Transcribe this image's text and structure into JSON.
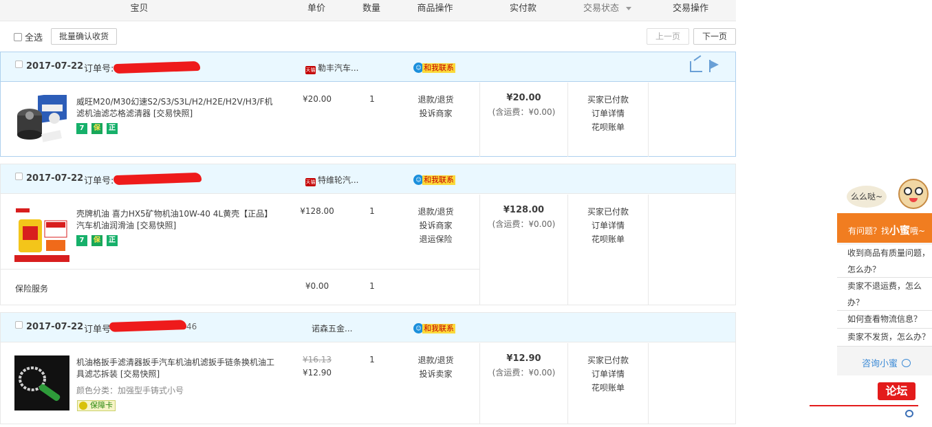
{
  "header": {
    "col_item": "宝贝",
    "col_price": "单价",
    "col_qty": "数量",
    "col_ops": "商品操作",
    "col_paid": "实付款",
    "col_status": "交易状态",
    "col_actions": "交易操作"
  },
  "toolbar": {
    "select_all": "全选",
    "batch_confirm": "批量确认收货",
    "prev_page": "上一页",
    "next_page": "下一页"
  },
  "orders": [
    {
      "date": "2017-07-22",
      "order_no_label": "订单号:",
      "order_no_tail": "",
      "shop": "勒丰汽车...",
      "contact": "和我联系",
      "items": [
        {
          "title": "威旺M20/M30幻速S2/S3/S3L/H2/H2E/H2V/H3/F机滤机油滤芯格滤清器",
          "snapshot": "[交易快照]",
          "badges": [
            "7",
            "保",
            "正"
          ],
          "price": "¥20.00",
          "qty": "1",
          "ops": [
            "退款/退货",
            "投诉商家"
          ]
        }
      ],
      "paid": "¥20.00",
      "shipping": "(含运费：¥0.00)",
      "status": [
        "买家已付款",
        "订单详情",
        "花呗账单"
      ]
    },
    {
      "date": "2017-07-22",
      "order_no_label": "订单号:",
      "order_no_tail": "",
      "shop": "特维轮汽...",
      "contact": "和我联系",
      "items": [
        {
          "title": "壳牌机油 喜力HX5矿物机油10W-40 4L黄壳【正品】汽车机油润滑油",
          "snapshot": "[交易快照]",
          "badges": [
            "7",
            "保",
            "正"
          ],
          "price": "¥128.00",
          "qty": "1",
          "ops": [
            "退款/退货",
            "投诉商家",
            "退运保险"
          ]
        },
        {
          "title": "保险服务",
          "price": "¥0.00",
          "qty": "1"
        }
      ],
      "paid": "¥128.00",
      "shipping": "(含运费：¥0.00)",
      "status": [
        "买家已付款",
        "订单详情",
        "花呗账单"
      ]
    },
    {
      "date": "2017-07-22",
      "order_no_label": "订单号",
      "order_no_tail": "46",
      "shop": "诺森五金...",
      "contact": "和我联系",
      "items": [
        {
          "title": "机油格扳手滤清器扳手汽车机油机滤扳手链条换机油工具滤芯拆装",
          "snapshot": "[交易快照]",
          "spec": "颜色分类：加强型手铸式小号",
          "badge_card": "保障卡",
          "price_old": "¥16.13",
          "price": "¥12.90",
          "qty": "1",
          "ops": [
            "退款/退货",
            "投诉卖家"
          ]
        }
      ],
      "paid": "¥12.90",
      "shipping": "(含运费：¥0.00)",
      "status": [
        "买家已付款",
        "订单详情",
        "花呗账单"
      ]
    }
  ],
  "widget": {
    "greeting": "么么哒~",
    "title_pre": "有问题？找",
    "title_big": "小蜜",
    "title_post": "哦~",
    "questions": [
      "收到商品有质量问题，怎么办？",
      "卖家不退运费，怎么办？",
      "如何查看物流信息？",
      "卖家不发货，怎么办？"
    ],
    "consult": "咨询小蜜"
  },
  "forum": {
    "label": "论坛"
  },
  "colors": {
    "order_header_bg": "#eaf8ff",
    "accent_orange": "#f17d20",
    "redaction": "#ee1b1b",
    "link_blue": "#3b8ad6"
  }
}
